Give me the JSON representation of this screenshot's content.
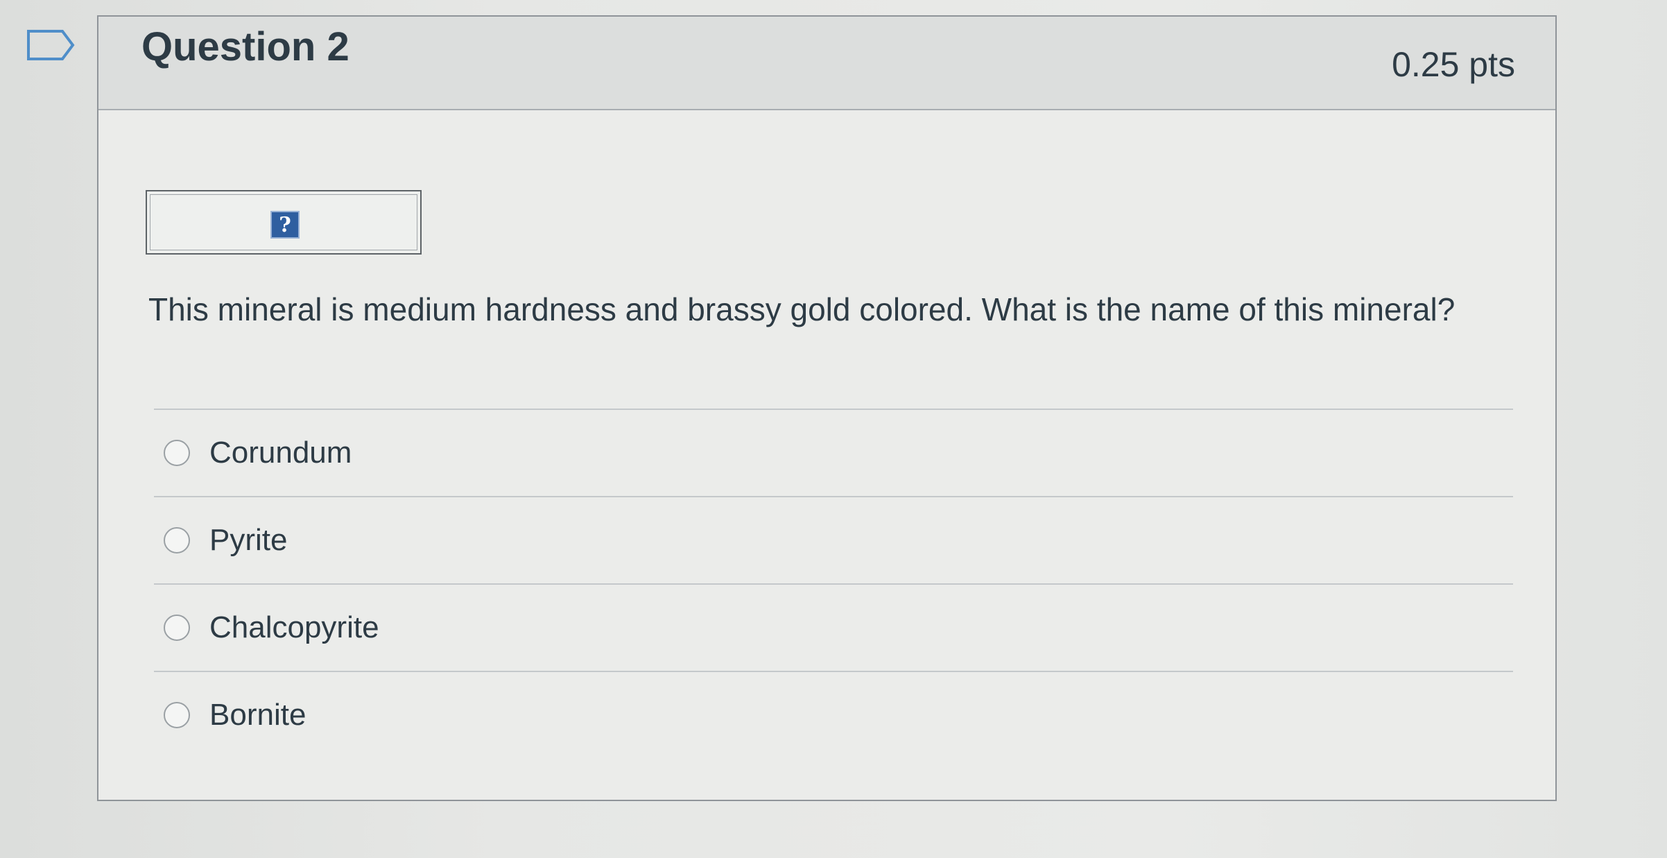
{
  "quiz": {
    "question_title": "Question 2",
    "points": "0.25 pts",
    "image_icon_name": "broken-image-icon",
    "image_icon_glyph": "?",
    "question_text": "This mineral is medium hardness and brassy gold colored.  What is the name of this mineral?",
    "answers": [
      {
        "label": "Corundum",
        "selected": false
      },
      {
        "label": "Pyrite",
        "selected": false
      },
      {
        "label": "Chalcopyrite",
        "selected": false
      },
      {
        "label": "Bornite",
        "selected": false
      }
    ]
  },
  "colors": {
    "text": "#2d3b45",
    "header_bg": "#dcdedd",
    "card_border": "#8f9499",
    "image_icon_bg": "#2f5fa0"
  }
}
